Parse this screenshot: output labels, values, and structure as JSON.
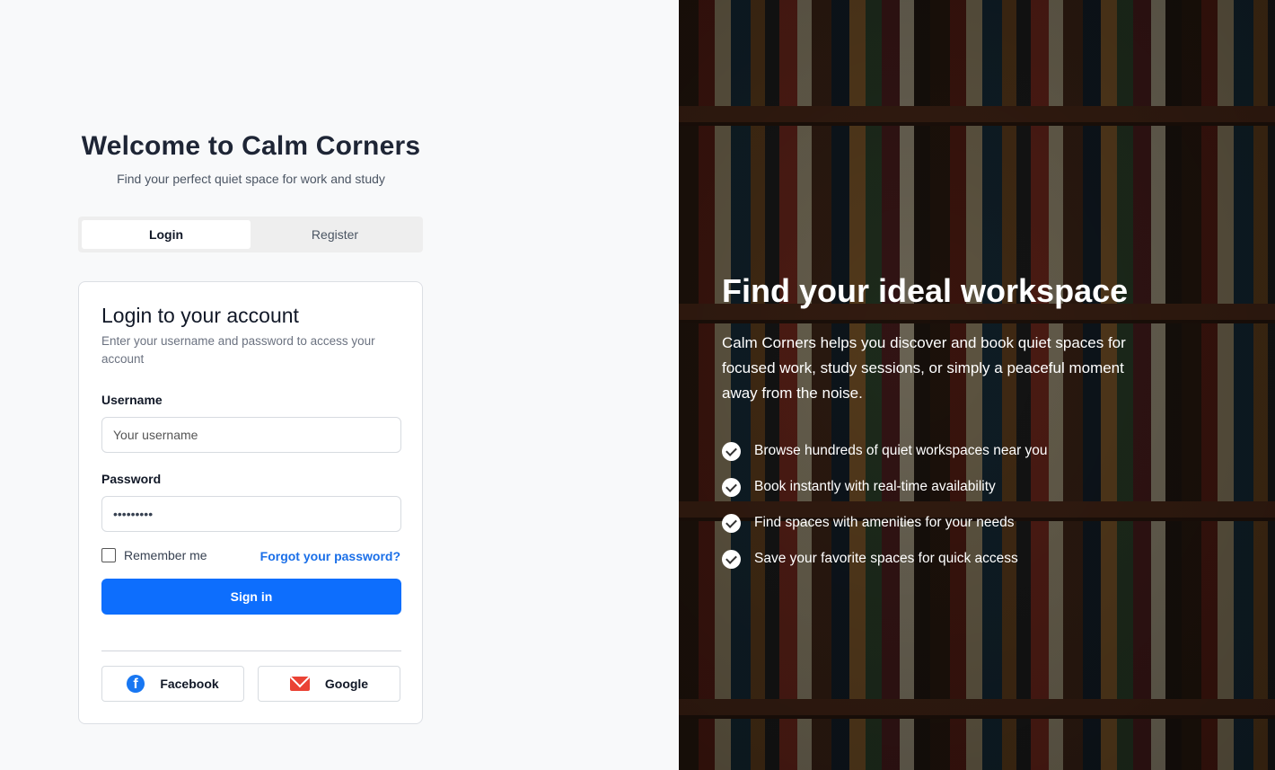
{
  "header": {
    "title": "Welcome to Calm Corners",
    "subtitle": "Find your perfect quiet space for work and study"
  },
  "tabs": [
    {
      "label": "Login",
      "active": true
    },
    {
      "label": "Register",
      "active": false
    }
  ],
  "login_card": {
    "title": "Login to your account",
    "description": "Enter your username and password to access your account",
    "username": {
      "label": "Username",
      "placeholder": "Your username",
      "value": ""
    },
    "password": {
      "label": "Password",
      "value": "•••••••••"
    },
    "remember_me": {
      "label": "Remember me",
      "checked": false
    },
    "forgot_password": "Forgot your password?",
    "sign_in": "Sign in",
    "social": [
      {
        "label": "Facebook",
        "icon": "facebook-icon"
      },
      {
        "label": "Google",
        "icon": "gmail-icon"
      }
    ]
  },
  "hero": {
    "title": "Find your ideal workspace",
    "text": "Calm Corners helps you discover and book quiet spaces for focused work, study sessions, or simply a peaceful moment away from the noise.",
    "features": [
      "Browse hundreds of quiet workspaces near you",
      "Book instantly with real-time availability",
      "Find spaces with amenities for your needs",
      "Save your favorite spaces for quick access"
    ]
  },
  "colors": {
    "primary": "#0d6efd",
    "link": "#1a6fe8",
    "heading": "#1e2535",
    "facebook": "#1877f2",
    "gmail": "#ea4335"
  }
}
